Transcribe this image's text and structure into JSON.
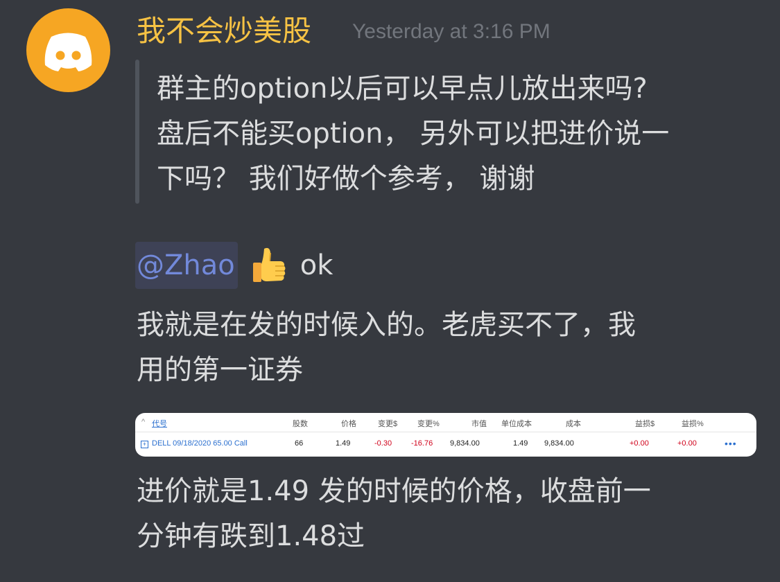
{
  "message": {
    "author": "我不会炒美股",
    "timestamp": "Yesterday at 3:16 PM",
    "avatar_icon": "discord-logo-icon",
    "avatar_color": "#f6a623",
    "quote_lines": [
      "群主的option以后可以早点儿放出来吗?",
      "盘后不能买option， 另外可以把进价说一",
      "下吗？ 我们好做个参考， 谢谢"
    ],
    "mention": "@Zhao",
    "emoji": "thumbs-up-icon",
    "reply_word": "ok",
    "body1_lines": [
      "我就是在发的时候入的。老虎买不了，我",
      "用的第一证券"
    ],
    "body2_lines": [
      "进价就是1.49 发的时候的价格，收盘前一",
      "分钟有跌到1.48过"
    ]
  },
  "embed_table": {
    "headers": {
      "symbol": "代号",
      "shares": "股数",
      "price": "价格",
      "change_usd": "变更$",
      "change_pct": "变更%",
      "market_value": "市值",
      "unit_cost": "单位成本",
      "cost": "成本",
      "pl_usd": "益损$",
      "pl_pct": "益损%"
    },
    "row": {
      "symbol": "DELL 09/18/2020 65.00 Call",
      "shares": "66",
      "price": "1.49",
      "change_usd": "-0.30",
      "change_pct": "-16.76",
      "market_value": "9,834.00",
      "unit_cost": "1.49",
      "cost": "9,834.00",
      "pl_usd": "+0.00",
      "pl_pct": "+0.00",
      "more": "•••"
    }
  },
  "colors": {
    "background": "#36393f",
    "username": "#f6c244",
    "timestamp": "#72767d",
    "text": "#dcddde",
    "mention": "#7289da",
    "mention_bg": "#3e4256",
    "negative": "#d0021b"
  }
}
